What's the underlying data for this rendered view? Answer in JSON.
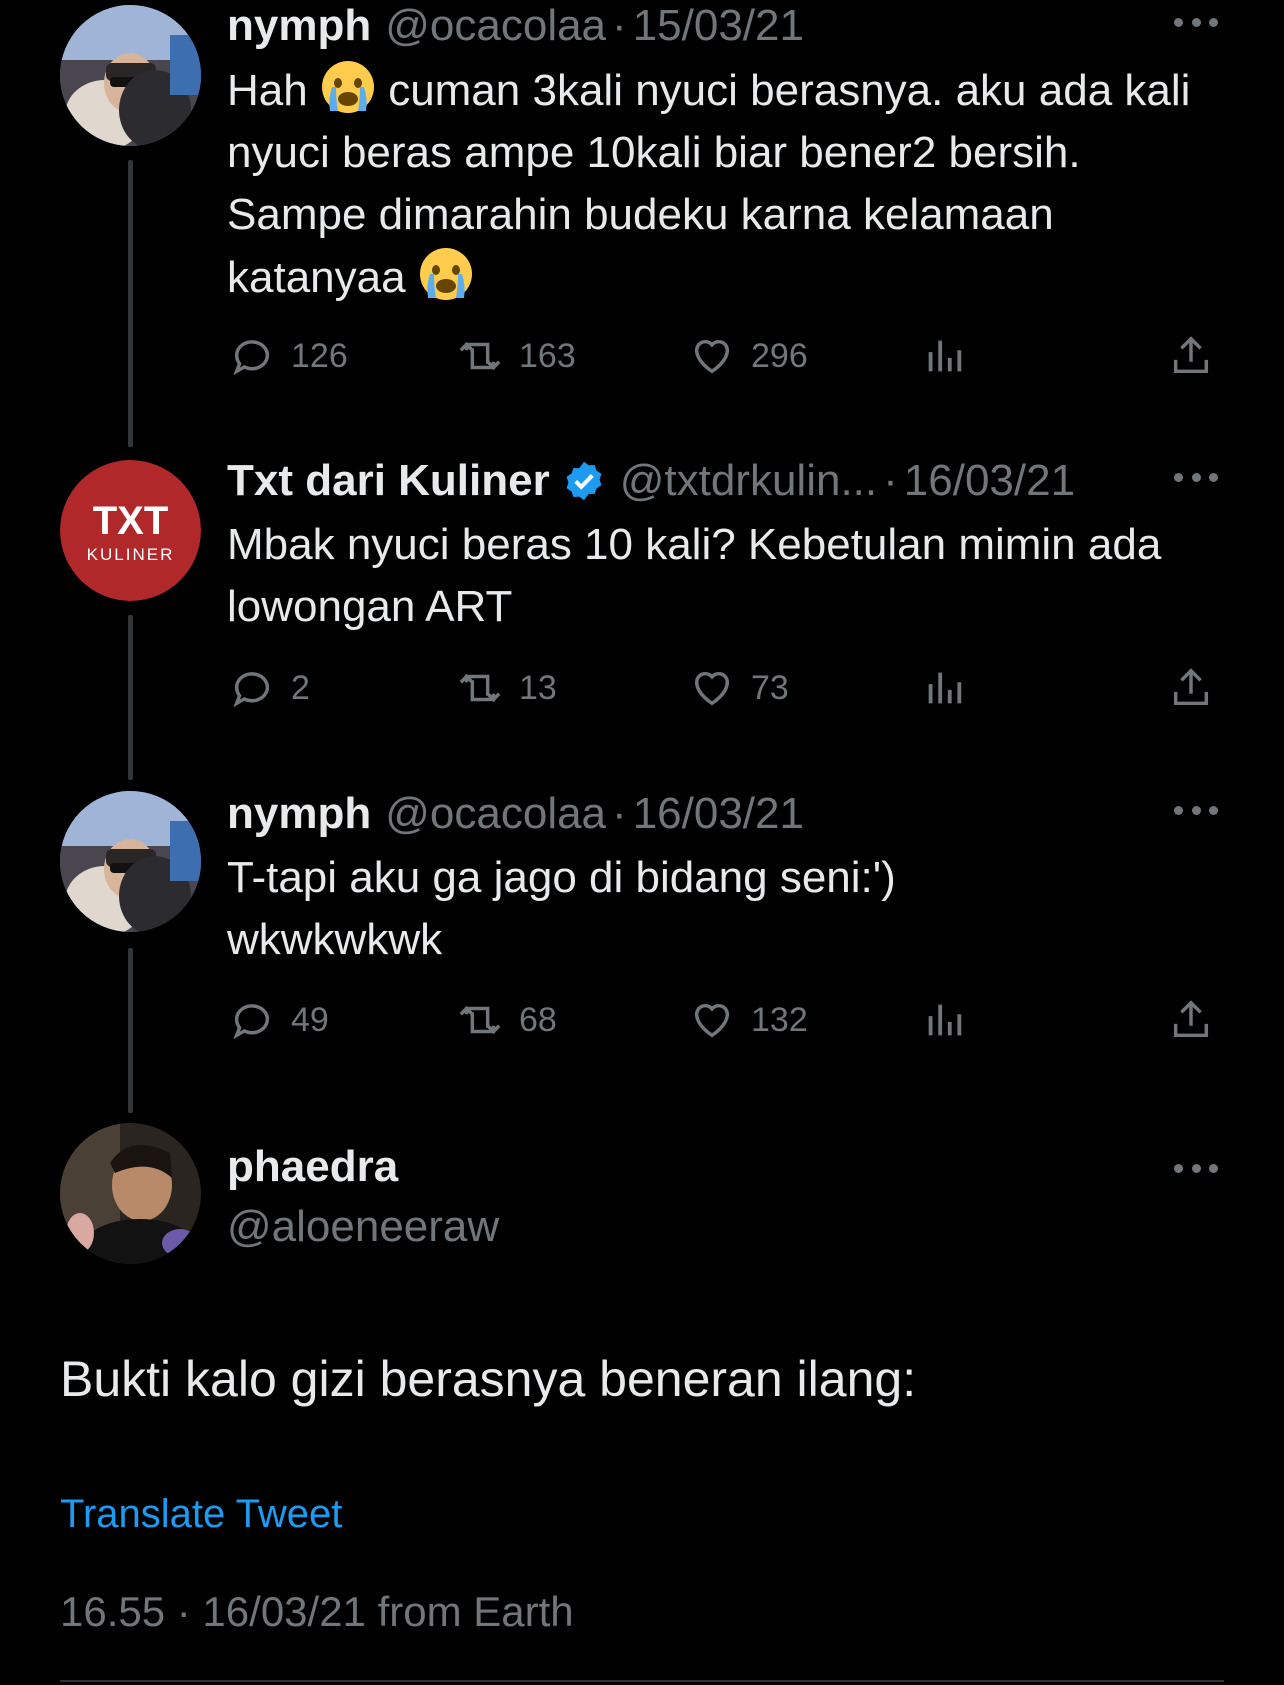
{
  "colors": {
    "background": "#000000",
    "text": "#e7e9ea",
    "muted": "#71767b",
    "link": "#1d9bf0",
    "verified": "#1d9bf0",
    "avatar_txt_bg": "#b0282a"
  },
  "replies": [
    {
      "name": "nymph",
      "handle": "@ocacolaa",
      "date": "15/03/21",
      "text_parts": [
        "Hah",
        " cuman 3kali nyuci berasnya. aku ada kali nyuci beras ampe 10kali biar bener2 bersih. Sampe dimarahin budeku karna kelamaan katanyaa",
        ""
      ],
      "emojis": [
        "crying-emoji",
        "crying-emoji"
      ],
      "replies": "126",
      "retweets": "163",
      "likes": "296"
    },
    {
      "name": "Txt dari Kuliner",
      "verified": true,
      "handle": "@txtdrkulin...",
      "date": "16/03/21",
      "text": "Mbak nyuci beras 10 kali? Kebetulan mimin ada lowongan ART",
      "avatar_text_top": "TXT",
      "avatar_text_bottom": "KULINER",
      "replies": "2",
      "retweets": "13",
      "likes": "73"
    },
    {
      "name": "nymph",
      "handle": "@ocacolaa",
      "date": "16/03/21",
      "text": "T-tapi aku ga jago di bidang seni:') wkwkwkwk",
      "replies": "49",
      "retweets": "68",
      "likes": "132"
    }
  ],
  "main_tweet": {
    "name": "phaedra",
    "handle": "@aloeneeraw",
    "text": "Bukti kalo gizi berasnya beneran ilang:",
    "translate": "Translate Tweet",
    "meta": "16.55 · 16/03/21 from Earth"
  },
  "separator": "·"
}
